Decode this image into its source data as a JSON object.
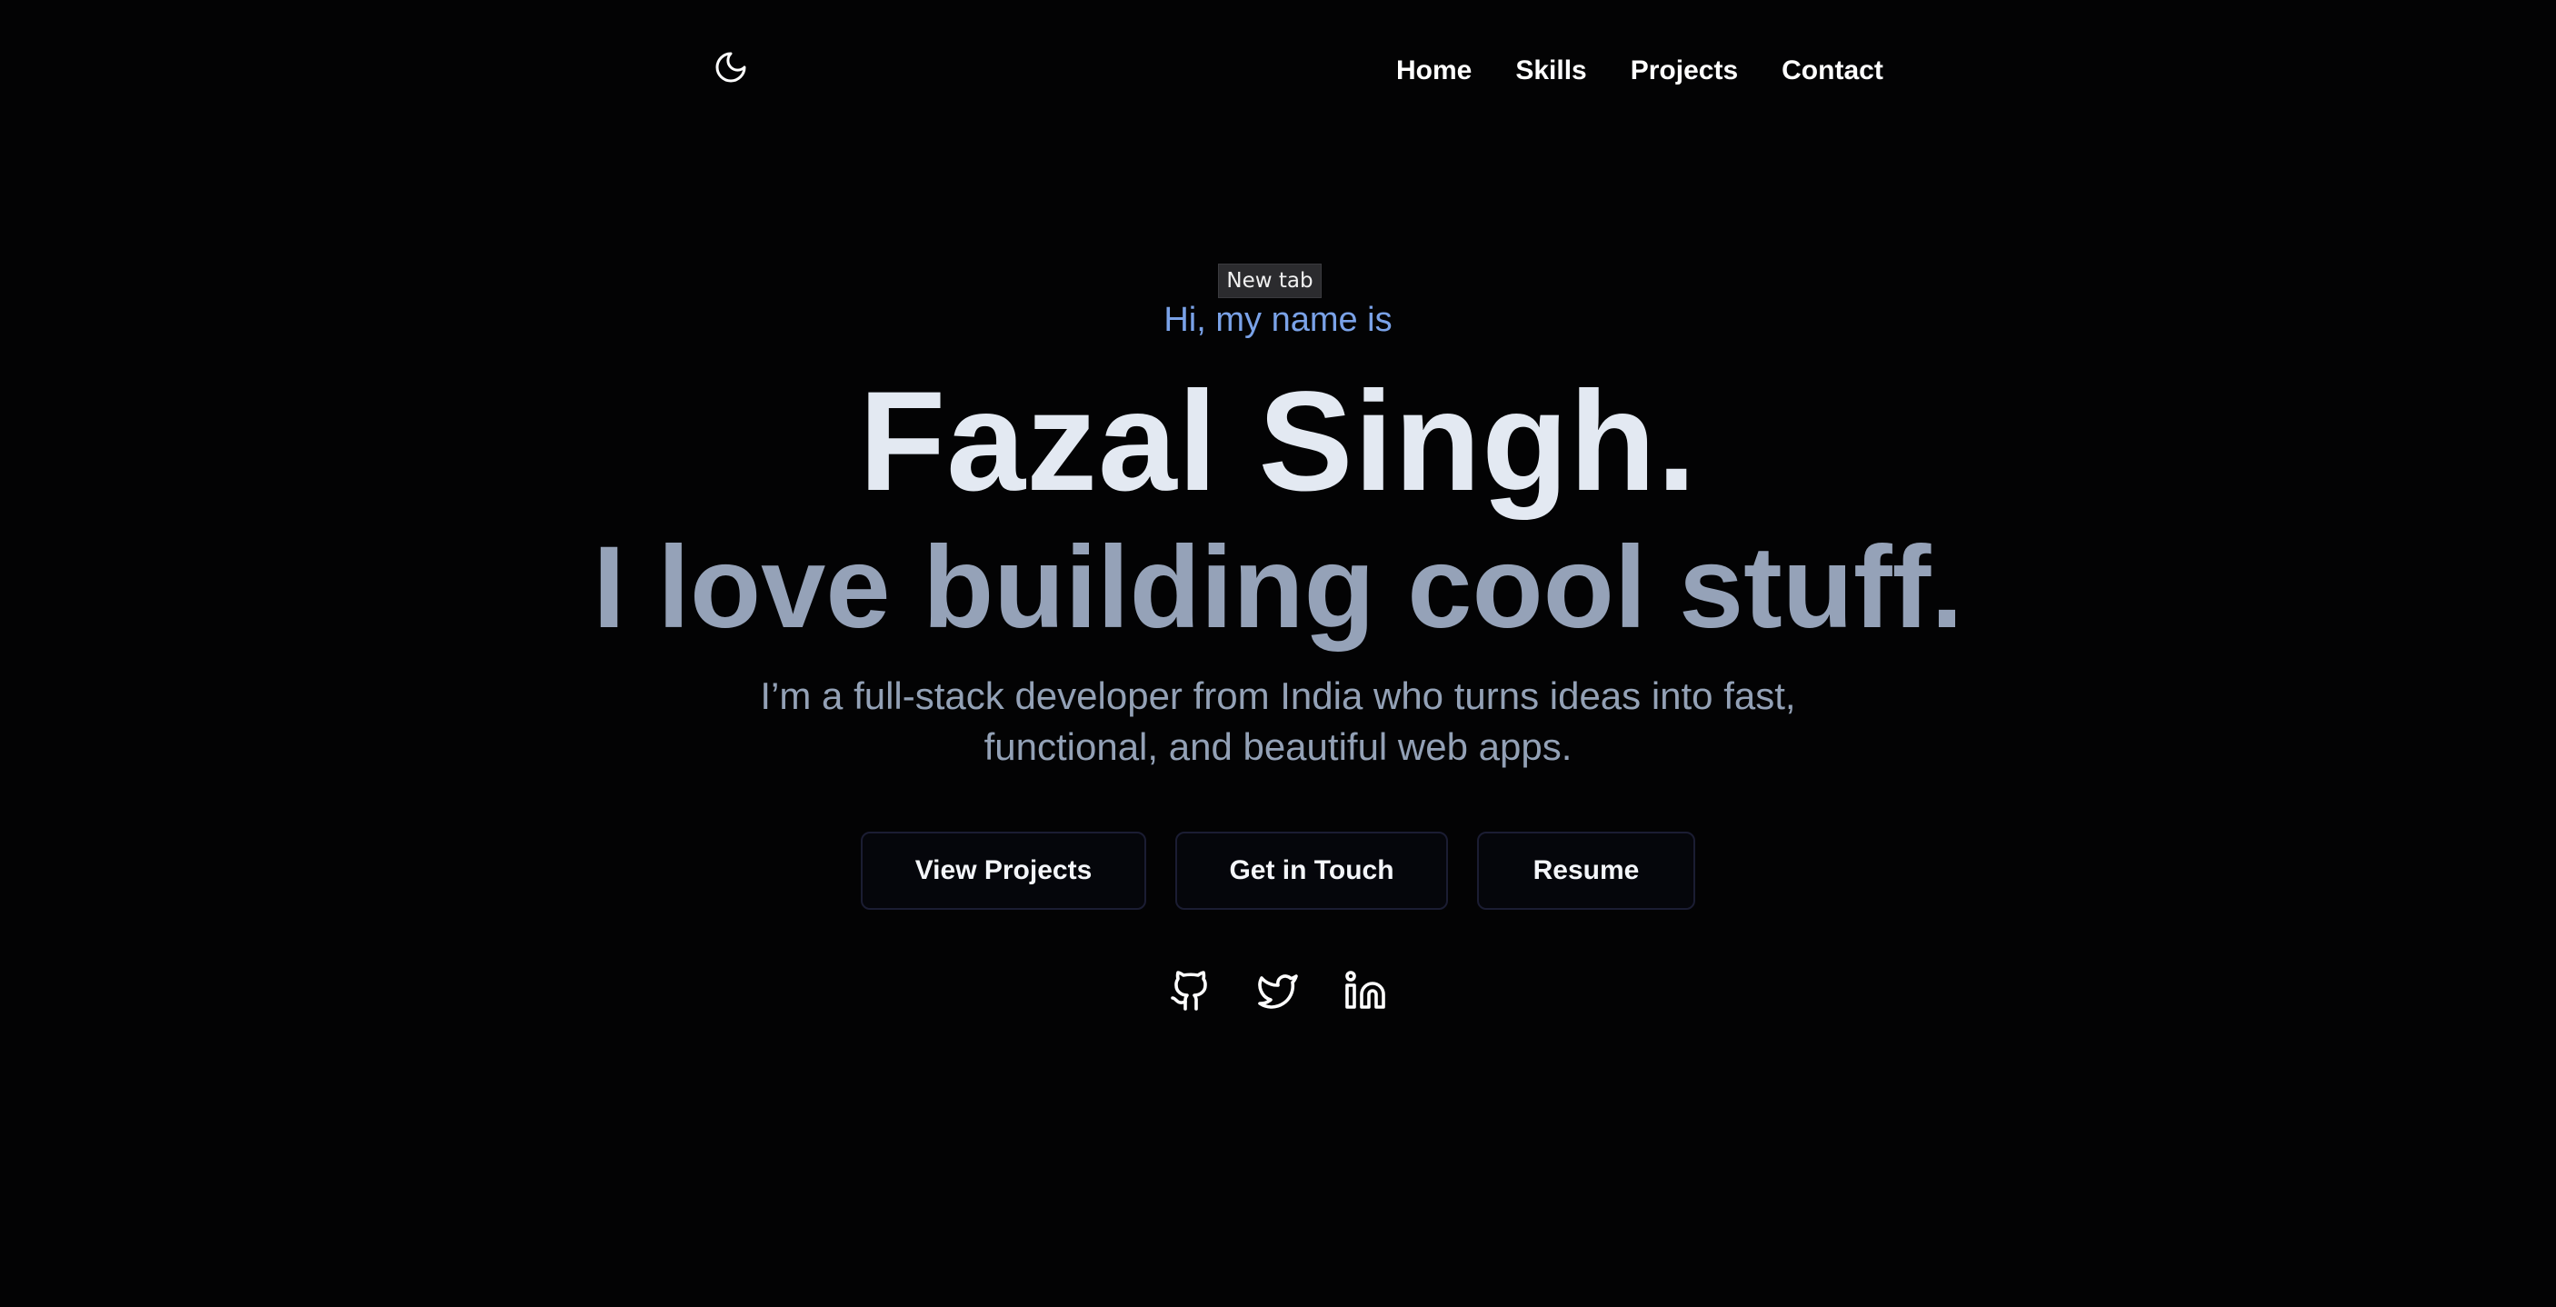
{
  "header": {
    "theme_toggle_icon": "moon-icon",
    "nav": [
      {
        "label": "Home"
      },
      {
        "label": "Skills"
      },
      {
        "label": "Projects"
      },
      {
        "label": "Contact"
      }
    ]
  },
  "tooltip": {
    "text": "New tab"
  },
  "hero": {
    "greeting": "Hi, my name is",
    "name": "Fazal Singh.",
    "tagline": "I love building cool stuff.",
    "description": "I’m a full-stack developer from India who turns ideas into fast, functional, and beautiful web apps.",
    "buttons": {
      "view_projects": "View Projects",
      "get_in_touch": "Get in Touch",
      "resume": "Resume"
    },
    "socials": [
      {
        "icon": "github-icon"
      },
      {
        "icon": "twitter-icon"
      },
      {
        "icon": "linkedin-icon"
      }
    ]
  },
  "colors": {
    "background": "#030304",
    "greeting_accent": "#7aa2e8",
    "name_text": "#e3e9f2",
    "tagline_text": "#95a2b8",
    "button_border": "#1b1d33"
  }
}
